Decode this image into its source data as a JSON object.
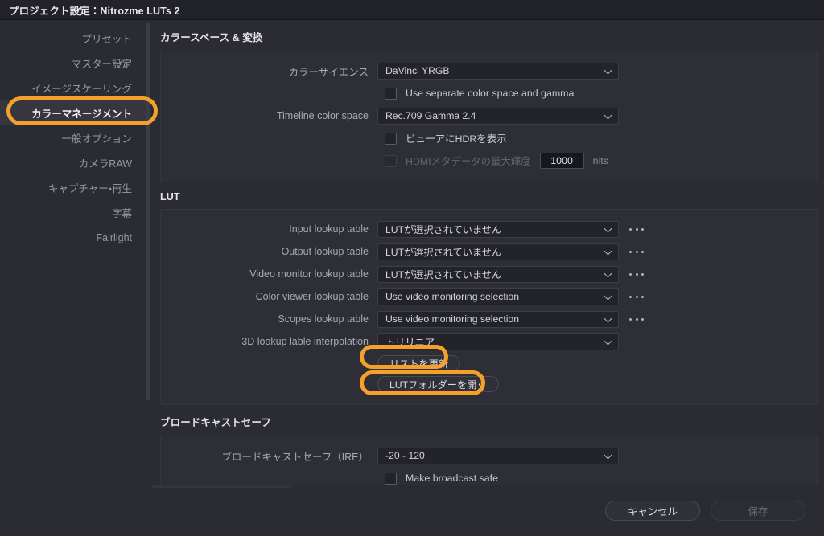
{
  "window": {
    "title": "プロジェクト設定：Nitrozme LUTs 2"
  },
  "sidebar": {
    "items": [
      {
        "label": "プリセット",
        "selected": false
      },
      {
        "label": "マスター設定",
        "selected": false
      },
      {
        "label": "イメージスケーリング",
        "selected": false
      },
      {
        "label": "カラーマネージメント",
        "selected": true
      },
      {
        "label": "一般オプション",
        "selected": false
      },
      {
        "label": "カメラRAW",
        "selected": false
      },
      {
        "label": "キャプチャー・再生",
        "selected": false
      },
      {
        "label": "字幕",
        "selected": false
      },
      {
        "label": "Fairlight",
        "selected": false
      }
    ]
  },
  "colorspace": {
    "section_title": "カラースペース & 変換",
    "color_science_label": "カラーサイエンス",
    "color_science_value": "DaVinci YRGB",
    "separate_space_label": "Use separate color space and gamma",
    "separate_space_checked": false,
    "timeline_label": "Timeline color space",
    "timeline_value": "Rec.709 Gamma 2.4",
    "hdr_viewer_label": "ビューアにHDRを表示",
    "hdr_viewer_checked": false,
    "hdmi_label": "HDMIメタデータの最大輝度",
    "hdmi_checked": false,
    "hdmi_value": "1000",
    "hdmi_unit": "nits"
  },
  "lut": {
    "section_title": "LUT",
    "rows": [
      {
        "label": "Input lookup table",
        "value": "LUTが選択されていません"
      },
      {
        "label": "Output lookup table",
        "value": "LUTが選択されていません"
      },
      {
        "label": "Video monitor lookup table",
        "value": "LUTが選択されていません"
      },
      {
        "label": "Color viewer lookup table",
        "value": "Use video monitoring selection"
      },
      {
        "label": "Scopes lookup table",
        "value": "Use video monitoring selection"
      }
    ],
    "interp_label": "3D lookup lable interpolation",
    "interp_value": "トリリニア",
    "refresh_button": "リストを更新",
    "open_folder_button": "LUTフォルダーを開く"
  },
  "broadcast": {
    "section_title": "ブロードキャストセーフ",
    "ire_label": "ブロードキャストセーフ（IRE）",
    "ire_value": "-20 - 120",
    "make_safe_label": "Make broadcast safe",
    "make_safe_checked": false
  },
  "footer": {
    "cancel_label": "キャンセル",
    "save_label": "保存",
    "save_enabled": false
  },
  "annotation": {
    "color": "#F5A02A"
  }
}
